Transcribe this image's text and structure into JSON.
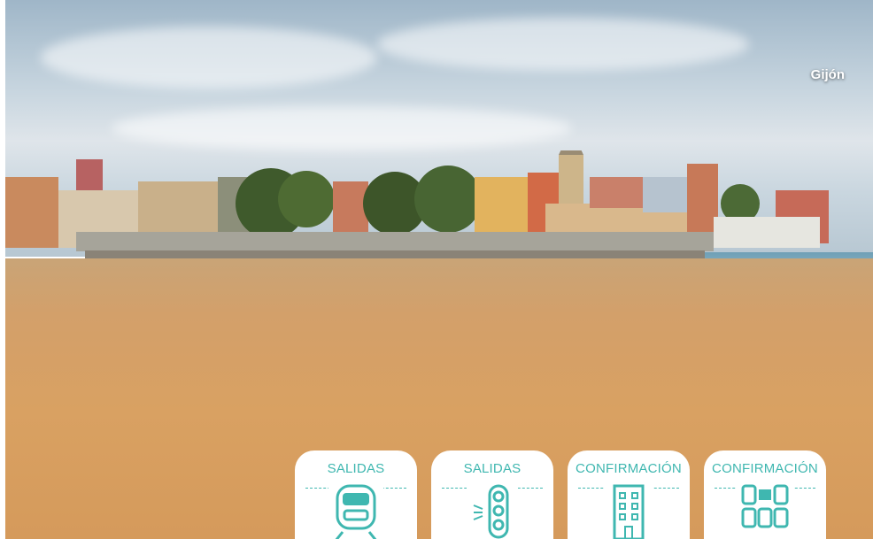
{
  "photo": {
    "location_label": "Gijón"
  },
  "cards": [
    {
      "label": "SALIDAS",
      "icon": "train-icon"
    },
    {
      "label": "SALIDAS",
      "icon": "traffic-light-icon"
    },
    {
      "label": "CONFIRMACIÓN",
      "icon": "hotel-building-icon"
    },
    {
      "label": "CONFIRMACIÓN",
      "icon": "seats-icon"
    }
  ],
  "colors": {
    "accent": "#3fb7b0",
    "card_bg": "#ffffff"
  }
}
